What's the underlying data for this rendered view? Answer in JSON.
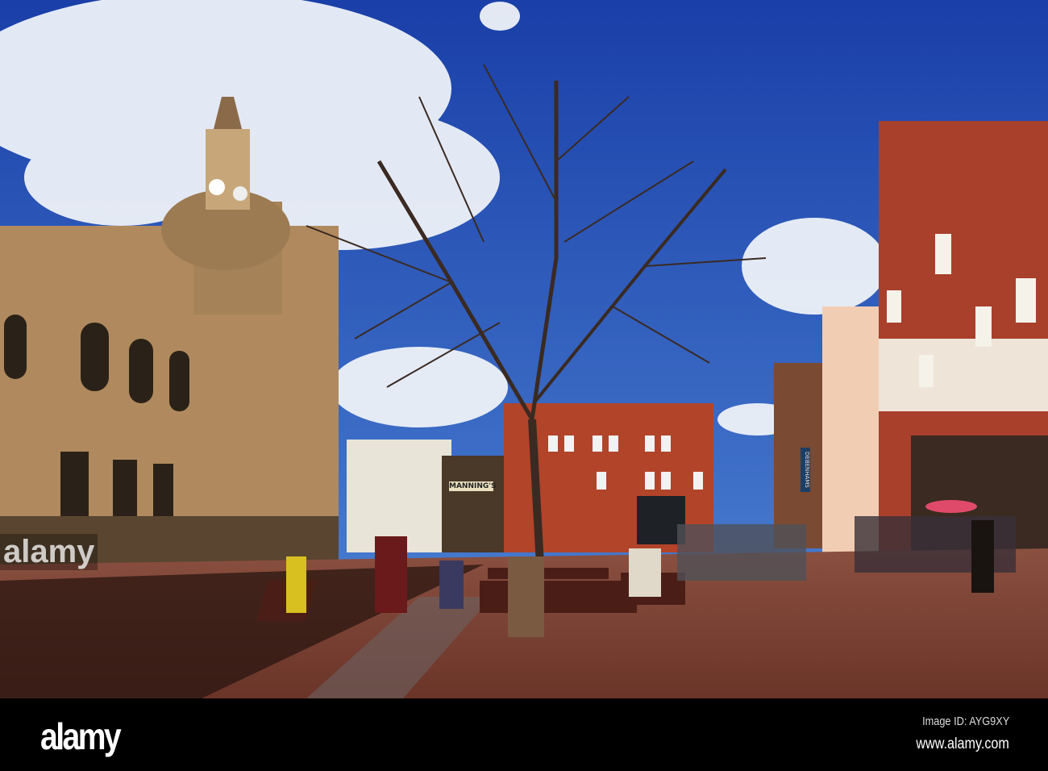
{
  "watermark": {
    "logo": "alamy",
    "image_id": "Image ID: AYG9XY",
    "website": "www.alamy.com",
    "overlay_text": "alamy"
  },
  "scene": {
    "shop_sign": "MANNING'S",
    "store_banner": "DEBENHAMS"
  },
  "colors": {
    "sky": "#1f4fb8",
    "pavement": "#7a4030",
    "brick": "#b2442a"
  }
}
